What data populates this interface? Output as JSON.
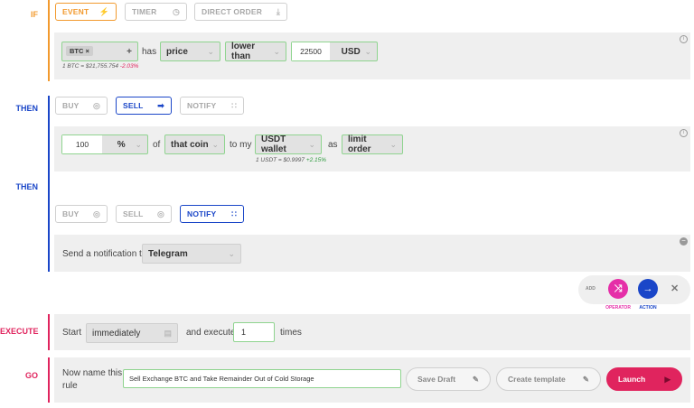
{
  "sections": {
    "if_label": "IF",
    "then_label_1": "THEN",
    "then_label_2": "THEN",
    "execute_label": "EXECUTE",
    "go_label": "GO"
  },
  "if_tabs": {
    "event": "EVENT",
    "timer": "TIMER",
    "direct_order": "DIRECT ORDER"
  },
  "condition": {
    "coin_chip": "BTC ×",
    "add_symbol": "+",
    "has_text": "has",
    "metric": "price",
    "comparator": "lower than",
    "amount": "22500",
    "currency": "USD",
    "quote_text": "1 BTC = $21,755.754",
    "quote_change": "-2.03%"
  },
  "action_tabs_1": {
    "buy": "BUY",
    "sell": "SELL",
    "notify": "NOTIFY"
  },
  "sell_action": {
    "quantity": "100",
    "unit": "%",
    "of_text": "of",
    "target": "that coin",
    "to_my_text": "to my",
    "wallet": "USDT wallet",
    "as_text": "as",
    "order_type": "limit order",
    "quote_text": "1 USDT = $0.9997",
    "quote_change": "+2.15%"
  },
  "action_tabs_2": {
    "buy": "BUY",
    "sell": "SELL",
    "notify": "NOTIFY"
  },
  "notify_action": {
    "prompt": "Send a notification to",
    "channel": "Telegram"
  },
  "add_controls": {
    "add_text": "ADD",
    "operator_label": "OPERATOR",
    "action_label": "ACTION",
    "close_symbol": "✕"
  },
  "execute": {
    "start_text": "Start",
    "timing": "immediately",
    "and_execute_text": "and execute",
    "times_value": "1",
    "times_text": "times"
  },
  "go": {
    "name_prompt_line1": "Now name this",
    "name_prompt_line2": "rule",
    "rule_name": "Sell Exchange BTC and Take Remainder Out of Cold Storage",
    "save_draft": "Save Draft",
    "create_template": "Create template",
    "launch": "Launch"
  },
  "colors": {
    "orange": "#f29a2e",
    "blue": "#1a46c8",
    "pink": "#e0245e",
    "green_border": "#8fd48f"
  }
}
